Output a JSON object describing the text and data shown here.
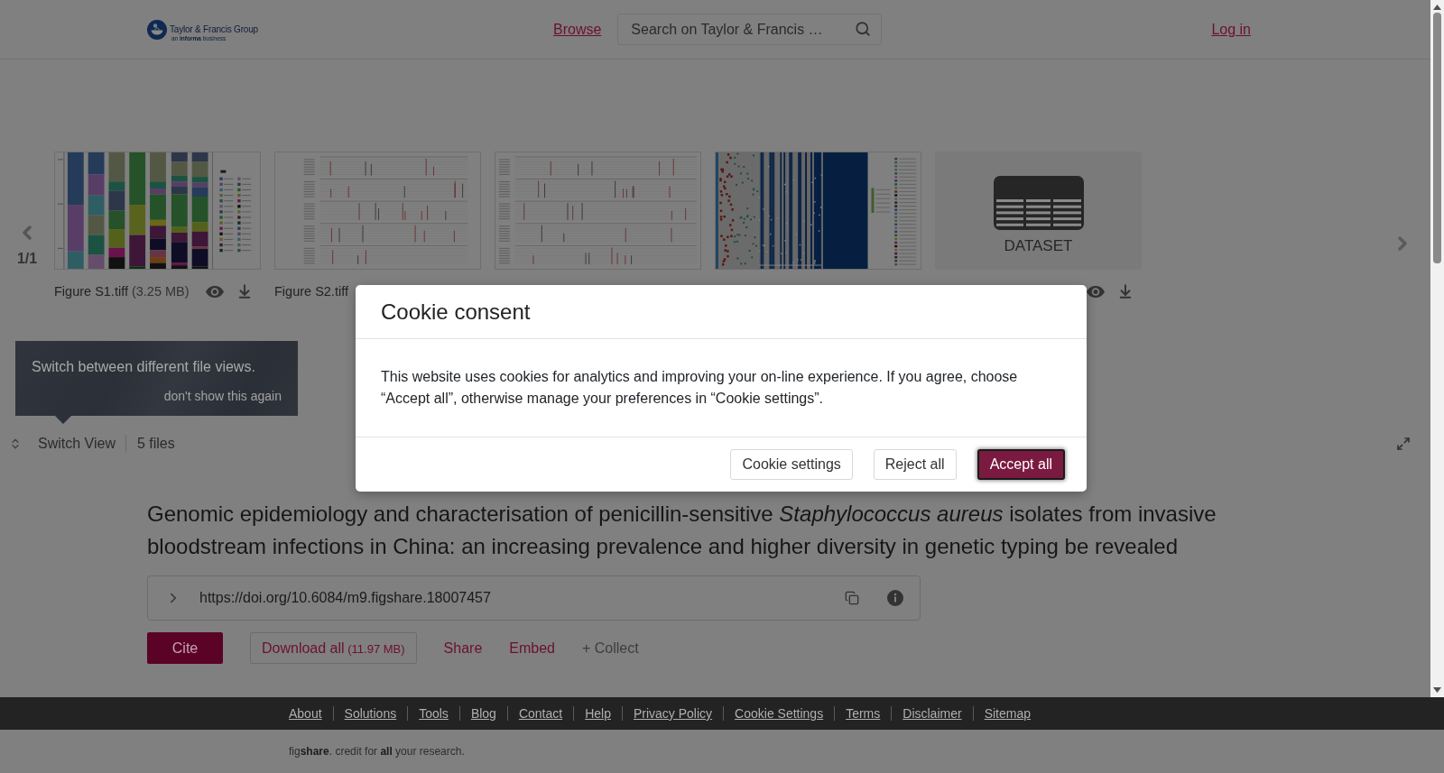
{
  "header": {
    "logo": {
      "name": "Taylor & Francis Group",
      "tagline": "an **informa** business"
    },
    "nav_link": "Browse",
    "search": {
      "placeholder": "Search on Taylor & Francis …"
    },
    "login": "Log in"
  },
  "file_viewer": {
    "pager": "1/1",
    "files": [
      {
        "kind": "stacked-bars",
        "name": "Figure S1.tiff",
        "size": "(3.25 MB)",
        "actions": true
      },
      {
        "kind": "alignment",
        "name": "Figure S2.tiff",
        "actions": false
      },
      {
        "kind": "alignment",
        "actions": false
      },
      {
        "kind": "heatmap",
        "actions": false
      },
      {
        "kind": "dataset",
        "label": "DATASET",
        "actions": true
      }
    ],
    "tooltip": {
      "text": "Switch between different file views.",
      "dismiss": "don't show this again"
    },
    "toolbar": {
      "switch_view": "Switch View",
      "file_count": "5 files"
    }
  },
  "article": {
    "title": "Genomic epidemiology and characterisation of penicillin-sensitive *Staphylococcus aureus* isolates from invasive bloodstream infections in China: an increasing prevalence and higher diversity in genetic typing be revealed",
    "doi": "https://doi.org/10.6084/m9.figshare.18007457",
    "actions": [
      {
        "kind": "primary",
        "label": "Cite"
      },
      {
        "kind": "outline",
        "label": "Download all",
        "detail": "(11.97 MB)"
      },
      {
        "kind": "link",
        "label": "Share"
      },
      {
        "kind": "link",
        "label": "Embed"
      },
      {
        "kind": "muted",
        "label": "+ Collect"
      }
    ]
  },
  "footer": {
    "links": [
      "About",
      "Solutions",
      "Tools",
      "Blog",
      "Contact",
      "Help",
      "Privacy Policy",
      "Cookie Settings",
      "Terms",
      "Disclaimer",
      "Sitemap"
    ],
    "tagline": "fig**share**. credit for **all** your research."
  },
  "cookie_dialog": {
    "title": "Cookie consent",
    "text": "This website uses cookies for analytics and improving your on-line experience. If you agree, choose “Accept all”, otherwise manage your preferences in “Cookie settings”.",
    "buttons": [
      {
        "label": "Cookie settings",
        "kind": "secondary",
        "focused": false
      },
      {
        "label": "Reject all",
        "kind": "secondary",
        "focused": false
      },
      {
        "label": "Accept all",
        "kind": "primary",
        "focused": true
      }
    ]
  }
}
